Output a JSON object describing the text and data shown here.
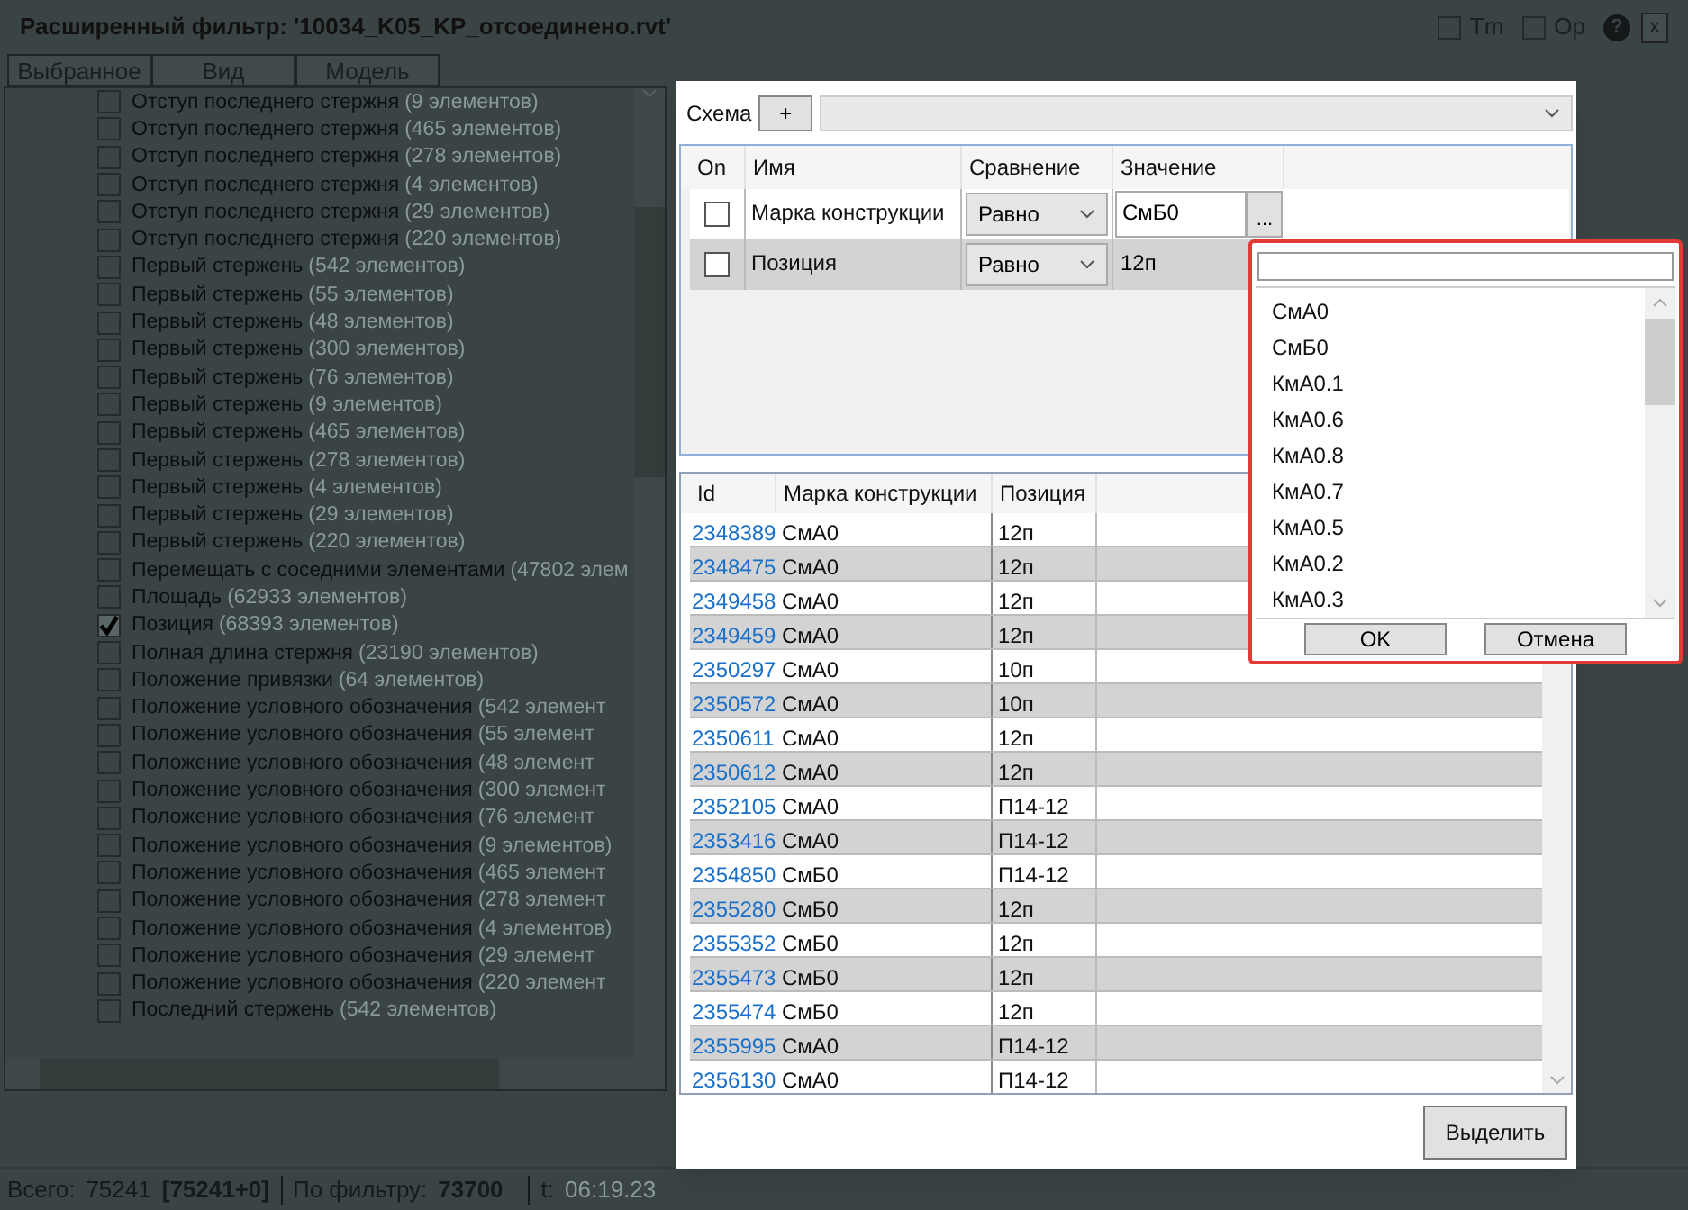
{
  "window": {
    "title": "Расширенный фильтр: '10034_K05_KP_отсоединено.rvt'",
    "options": [
      {
        "label": "Tm",
        "checked": false
      },
      {
        "label": "Op",
        "checked": false
      }
    ],
    "help": "?",
    "close": "x"
  },
  "source_buttons": [
    "Выбранное",
    "Вид",
    "Модель"
  ],
  "parameters": [
    {
      "name": "Отступ последнего стержня",
      "count": "(9 элементов)",
      "checked": false
    },
    {
      "name": "Отступ последнего стержня",
      "count": "(465 элементов)",
      "checked": false
    },
    {
      "name": "Отступ последнего стержня",
      "count": "(278 элементов)",
      "checked": false
    },
    {
      "name": "Отступ последнего стержня",
      "count": "(4 элементов)",
      "checked": false
    },
    {
      "name": "Отступ последнего стержня",
      "count": "(29 элементов)",
      "checked": false
    },
    {
      "name": "Отступ последнего стержня",
      "count": "(220 элементов)",
      "checked": false
    },
    {
      "name": "Первый стержень",
      "count": "(542 элементов)",
      "checked": false
    },
    {
      "name": "Первый стержень",
      "count": "(55 элементов)",
      "checked": false
    },
    {
      "name": "Первый стержень",
      "count": "(48 элементов)",
      "checked": false
    },
    {
      "name": "Первый стержень",
      "count": "(300 элементов)",
      "checked": false
    },
    {
      "name": "Первый стержень",
      "count": "(76 элементов)",
      "checked": false
    },
    {
      "name": "Первый стержень",
      "count": "(9 элементов)",
      "checked": false
    },
    {
      "name": "Первый стержень",
      "count": "(465 элементов)",
      "checked": false
    },
    {
      "name": "Первый стержень",
      "count": "(278 элементов)",
      "checked": false
    },
    {
      "name": "Первый стержень",
      "count": "(4 элементов)",
      "checked": false
    },
    {
      "name": "Первый стержень",
      "count": "(29 элементов)",
      "checked": false
    },
    {
      "name": "Первый стержень",
      "count": "(220 элементов)",
      "checked": false
    },
    {
      "name": "Перемещать с соседними элементами",
      "count": "(47802 элем",
      "checked": false
    },
    {
      "name": "Площадь",
      "count": "(62933 элементов)",
      "checked": false
    },
    {
      "name": "Позиция",
      "count": "(68393 элементов)",
      "checked": true
    },
    {
      "name": "Полная длина стержня",
      "count": "(23190 элементов)",
      "checked": false
    },
    {
      "name": "Положение привязки",
      "count": "(64 элементов)",
      "checked": false
    },
    {
      "name": "Положение условного обозначения",
      "count": "(542 элемент",
      "checked": false
    },
    {
      "name": "Положение условного обозначения",
      "count": "(55 элемент",
      "checked": false
    },
    {
      "name": "Положение условного обозначения",
      "count": "(48 элемент",
      "checked": false
    },
    {
      "name": "Положение условного обозначения",
      "count": "(300 элемент",
      "checked": false
    },
    {
      "name": "Положение условного обозначения",
      "count": "(76 элемент",
      "checked": false
    },
    {
      "name": "Положение условного обозначения",
      "count": "(9 элементов)",
      "checked": false
    },
    {
      "name": "Положение условного обозначения",
      "count": "(465 элемент",
      "checked": false
    },
    {
      "name": "Положение условного обозначения",
      "count": "(278 элемент",
      "checked": false
    },
    {
      "name": "Положение условного обозначения",
      "count": "(4 элементов)",
      "checked": false
    },
    {
      "name": "Положение условного обозначения",
      "count": "(29 элемент",
      "checked": false
    },
    {
      "name": "Положение условного обозначения",
      "count": "(220 элемент",
      "checked": false
    },
    {
      "name": "Последний стержень",
      "count": "(542 элементов)",
      "checked": false
    }
  ],
  "status": {
    "total_label": "Всего:",
    "total": "75241",
    "breakdown": "[75241+0]",
    "filter_label": "По фильтру:",
    "filter_count": "73700",
    "time_label": "t:",
    "time": "06:19.23"
  },
  "dialog": {
    "schema_label": "Схема",
    "add": "+",
    "filter_columns": [
      "On",
      "Имя",
      "Сравнение",
      "Значение"
    ],
    "filters": [
      {
        "checked": false,
        "name": "Марка конструкции",
        "comparison": "Равно",
        "value": "СмБ0",
        "kind": "picker"
      },
      {
        "checked": false,
        "name": "Позиция",
        "comparison": "Равно",
        "value": "12п",
        "kind": "text"
      }
    ],
    "picker_button": "...",
    "result_columns": [
      "Id",
      "Марка конструкции",
      "Позиция"
    ],
    "rows": [
      [
        "2348389",
        "СмА0",
        "12п"
      ],
      [
        "2348475",
        "СмА0",
        "12п"
      ],
      [
        "2349458",
        "СмА0",
        "12п"
      ],
      [
        "2349459",
        "СмА0",
        "12п"
      ],
      [
        "2350297",
        "СмА0",
        "10п"
      ],
      [
        "2350572",
        "СмА0",
        "10п"
      ],
      [
        "2350611",
        "СмА0",
        "12п"
      ],
      [
        "2350612",
        "СмА0",
        "12п"
      ],
      [
        "2352105",
        "СмА0",
        "П14-12"
      ],
      [
        "2353416",
        "СмА0",
        "П14-12"
      ],
      [
        "2354850",
        "СмБ0",
        "П14-12"
      ],
      [
        "2355280",
        "СмБ0",
        "12п"
      ],
      [
        "2355352",
        "СмБ0",
        "12п"
      ],
      [
        "2355473",
        "СмБ0",
        "12п"
      ],
      [
        "2355474",
        "СмБ0",
        "12п"
      ],
      [
        "2355995",
        "СмА0",
        "П14-12"
      ],
      [
        "2356130",
        "СмА0",
        "П14-12"
      ]
    ],
    "select_button": "Выделить"
  },
  "popup": {
    "items": [
      "СмА0",
      "СмБ0",
      "КмА0.1",
      "КмА0.6",
      "КмА0.8",
      "КмА0.7",
      "КмА0.5",
      "КмА0.2",
      "КмА0.3"
    ],
    "ok": "OK",
    "cancel": "Отмена"
  }
}
